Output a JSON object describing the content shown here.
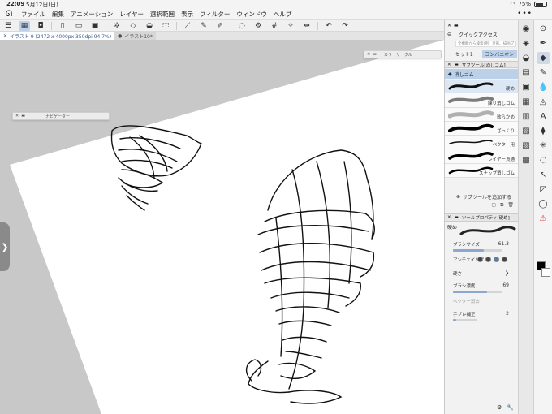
{
  "status": {
    "time": "22:09",
    "date": "5月12日(日)",
    "battery": "75%",
    "battery_fraction": 0.75
  },
  "menu": {
    "items": [
      "ファイル",
      "編集",
      "アニメーション",
      "レイヤー",
      "選択範囲",
      "表示",
      "フィルター",
      "ウィンドウ",
      "ヘルプ"
    ],
    "more": "•••"
  },
  "tabs": [
    {
      "label": "イラスト 9 (2472 x 4000px 350dpi 94.7%)",
      "active": true
    },
    {
      "label": "イラスト10*",
      "active": false
    }
  ],
  "floating": {
    "navigator": "ナビゲーター",
    "color_circle": "カラーサークル"
  },
  "panel": {
    "quick_access": "クイックアクセス",
    "qa_hint": "全機能から検索(例：変形、描画ブラシ…)",
    "set_label": "セット1",
    "set_tab": "コンバニオン",
    "subtool_header": "サブツール[消しゴム]",
    "subtool_tab": "消しゴム",
    "brushes": [
      {
        "name": "硬め",
        "selected": true
      },
      {
        "name": "練り消しゴム",
        "selected": false
      },
      {
        "name": "軟らかめ",
        "selected": false
      },
      {
        "name": "ざっくり",
        "selected": false
      },
      {
        "name": "ベクター用",
        "selected": false
      },
      {
        "name": "レイヤー貫通",
        "selected": false
      },
      {
        "name": "スナップ消しゴム",
        "selected": false
      }
    ],
    "add_subtool": "サブツールを追加する",
    "tool_property_header": "ツールプロパティ[硬め]",
    "prop_tab": "硬め",
    "brush_size_label": "ブラシサイズ",
    "brush_size_value": "61.3",
    "antialias_label": "アンチエイリアス",
    "hardness_label": "硬さ",
    "brush_density_label": "ブラシ濃度",
    "brush_density_value": "69",
    "vector_erase_label": "ベクター消去",
    "stabilization_label": "手ブレ補正",
    "stabilization_value": "2"
  },
  "colors": {
    "accent": "#bcd0ea",
    "main_color": "#000000",
    "sub_color": "#ffffff"
  }
}
